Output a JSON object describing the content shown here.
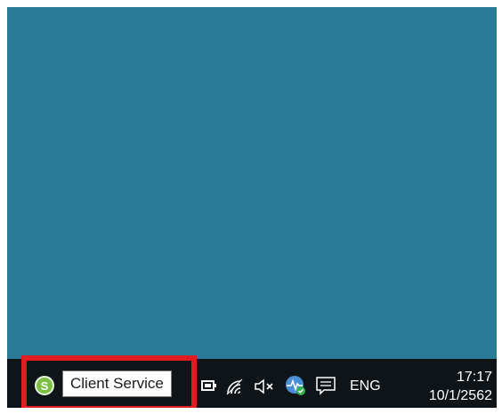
{
  "desktop": {
    "background_color": "#2a7b98"
  },
  "taskbar": {
    "background_color": "#0e1418",
    "tray": {
      "app_icon": {
        "icon": "green-s-app-icon",
        "glyph": "S"
      },
      "tooltip": {
        "text": "Client Service"
      },
      "icons": [
        "battery-icon",
        "wifi-icon",
        "volume-muted-icon",
        "network-activity-app-icon",
        "notification-icon"
      ],
      "language": "ENG",
      "clock": {
        "time": "17:17",
        "date": "10/1/2562"
      }
    }
  },
  "highlight": {
    "color": "#e31c23"
  }
}
